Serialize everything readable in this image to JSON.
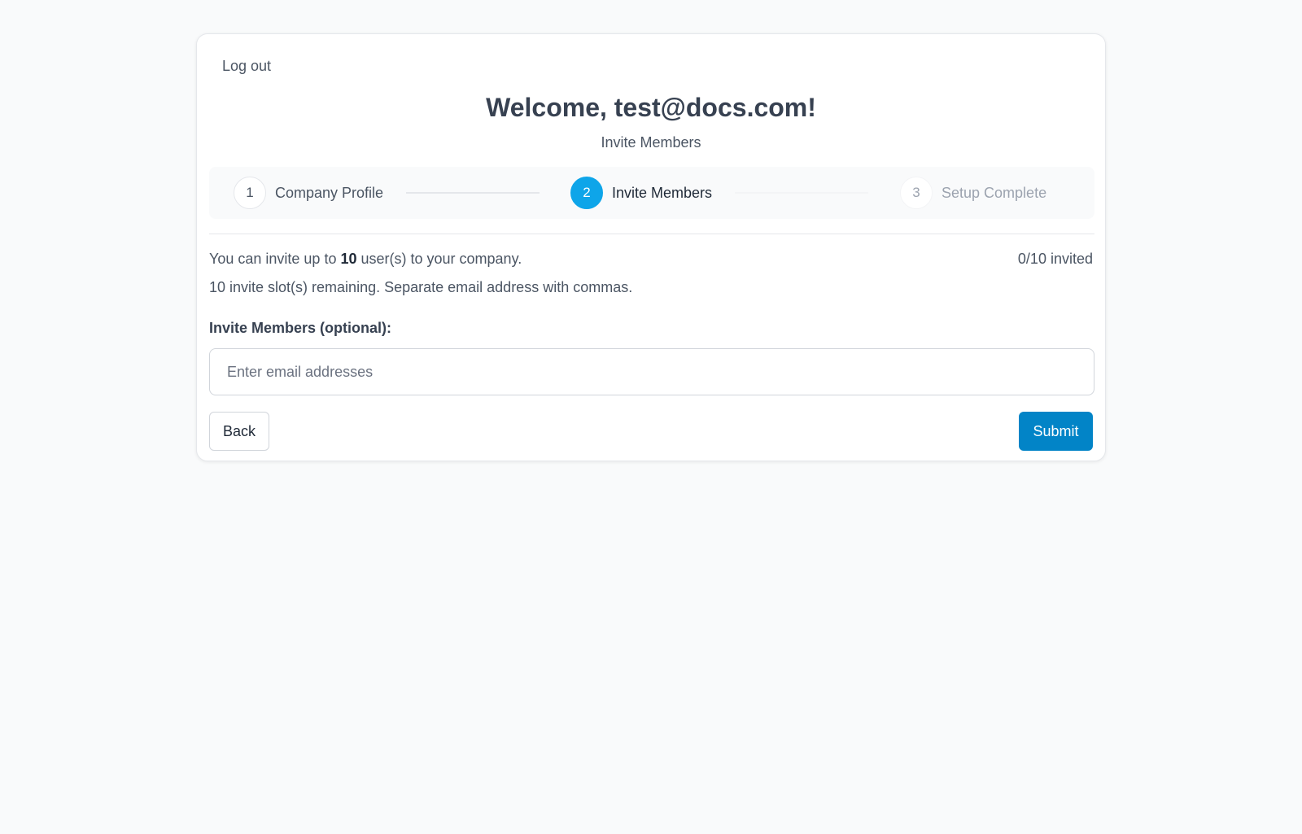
{
  "header": {
    "logout_label": "Log out",
    "title": "Welcome, test@docs.com!",
    "subtitle": "Invite Members"
  },
  "stepper": {
    "steps": [
      {
        "number": "1",
        "label": "Company Profile",
        "state": "completed"
      },
      {
        "number": "2",
        "label": "Invite Members",
        "state": "active"
      },
      {
        "number": "3",
        "label": "Setup Complete",
        "state": "upcoming"
      }
    ]
  },
  "invite": {
    "info_prefix": "You can invite up to ",
    "max_users": "10",
    "info_suffix": " user(s) to your company.",
    "invited_count": "0/10 invited",
    "remaining_text": "10 invite slot(s) remaining. Separate email address with commas.",
    "field_label": "Invite Members (optional):",
    "email_placeholder": "Enter email addresses",
    "email_value": ""
  },
  "actions": {
    "back_label": "Back",
    "submit_label": "Submit"
  },
  "colors": {
    "accent": "#0ea5e9",
    "submit": "#0284c7",
    "background": "#f9fafb"
  }
}
